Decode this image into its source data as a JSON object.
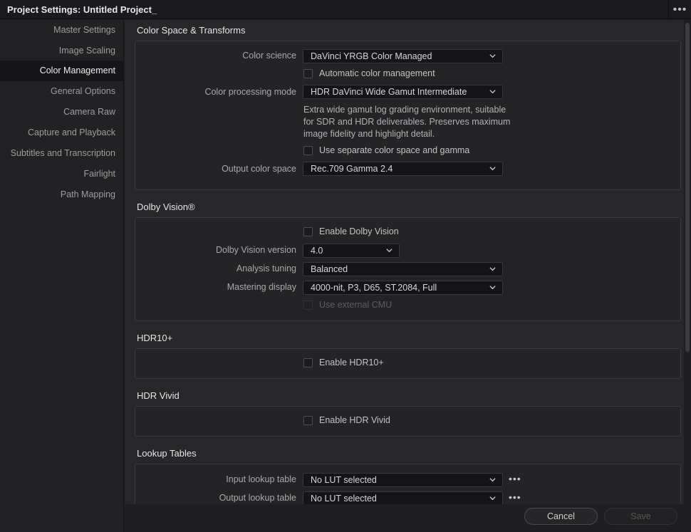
{
  "window": {
    "title": "Project Settings:  Untitled Project_"
  },
  "sidebar": {
    "items": [
      {
        "label": "Master Settings"
      },
      {
        "label": "Image Scaling"
      },
      {
        "label": "Color Management"
      },
      {
        "label": "General Options"
      },
      {
        "label": "Camera Raw"
      },
      {
        "label": "Capture and Playback"
      },
      {
        "label": "Subtitles and Transcription"
      },
      {
        "label": "Fairlight"
      },
      {
        "label": "Path Mapping"
      }
    ],
    "active_index": 2
  },
  "color_space": {
    "title": "Color Space & Transforms",
    "color_science_label": "Color science",
    "color_science_value": "DaVinci YRGB Color Managed",
    "auto_cm_label": "Automatic color management",
    "auto_cm_checked": false,
    "processing_mode_label": "Color processing mode",
    "processing_mode_value": "HDR DaVinci Wide Gamut Intermediate",
    "processing_mode_note": "Extra wide gamut log grading environment, suitable for SDR and HDR deliverables. Preserves maximum image fidelity and highlight detail.",
    "separate_label": "Use separate color space and gamma",
    "separate_checked": false,
    "output_label": "Output color space",
    "output_value": "Rec.709 Gamma 2.4"
  },
  "dolby": {
    "title": "Dolby Vision®",
    "enable_label": "Enable Dolby Vision",
    "enable_checked": false,
    "version_label": "Dolby Vision version",
    "version_value": "4.0",
    "tuning_label": "Analysis tuning",
    "tuning_value": "Balanced",
    "mastering_label": "Mastering display",
    "mastering_value": "4000-nit, P3, D65, ST.2084, Full",
    "cmu_label": "Use external CMU",
    "cmu_checked": false
  },
  "hdr10": {
    "title": "HDR10+",
    "enable_label": "Enable HDR10+",
    "enable_checked": false
  },
  "hdrvivid": {
    "title": "HDR Vivid",
    "enable_label": "Enable HDR Vivid",
    "enable_checked": false
  },
  "lut": {
    "title": "Lookup Tables",
    "input_label": "Input lookup table",
    "input_value": "No LUT selected",
    "output_label": "Output lookup table",
    "output_value": "No LUT selected"
  },
  "footer": {
    "cancel_label": "Cancel",
    "save_label": "Save"
  },
  "icons": {
    "more": "more-horizontal-icon",
    "chevron": "chevron-down-icon"
  }
}
